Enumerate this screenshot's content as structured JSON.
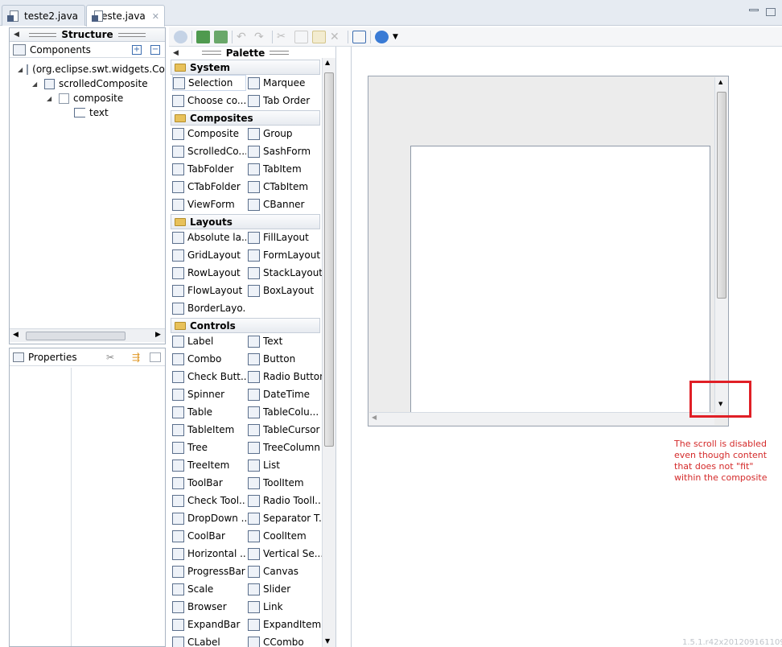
{
  "tabs": [
    {
      "label": "teste2.java",
      "active": false
    },
    {
      "label": "teste.java",
      "active": true
    }
  ],
  "structure": {
    "title": "Structure",
    "components_label": "Components",
    "tree": [
      {
        "label": "(org.eclipse.swt.widgets.Composite)",
        "level": 0
      },
      {
        "label": "scrolledComposite",
        "level": 1
      },
      {
        "label": "composite",
        "level": 2
      },
      {
        "label": "text",
        "level": 3
      }
    ]
  },
  "properties": {
    "title": "Properties"
  },
  "palette": {
    "title": "Palette",
    "categories": [
      {
        "name": "System",
        "items": [
          "Selection",
          "Marquee",
          "Choose co...",
          "Tab Order"
        ]
      },
      {
        "name": "Composites",
        "items": [
          "Composite",
          "Group",
          "ScrolledCo...",
          "SashForm",
          "TabFolder",
          "TabItem",
          "CTabFolder",
          "CTabItem",
          "ViewForm",
          "CBanner"
        ]
      },
      {
        "name": "Layouts",
        "items": [
          "Absolute la...",
          "FillLayout",
          "GridLayout",
          "FormLayout",
          "RowLayout",
          "StackLayout",
          "FlowLayout",
          "BoxLayout",
          "BorderLayo..."
        ]
      },
      {
        "name": "Controls",
        "items": [
          "Label",
          "Text",
          "Combo",
          "Button",
          "Check Butt...",
          "Radio Button",
          "Spinner",
          "DateTime",
          "Table",
          "TableColu...",
          "TableItem",
          "TableCursor",
          "Tree",
          "TreeColumn",
          "TreeItem",
          "List",
          "ToolBar",
          "ToolItem",
          "Check Tool...",
          "Radio Tooll...",
          "DropDown ...",
          "Separator T...",
          "CoolBar",
          "CoolItem",
          "Horizontal ...",
          "Vertical Se...",
          "ProgressBar",
          "Canvas",
          "Scale",
          "Slider",
          "Browser",
          "Link",
          "ExpandBar",
          "ExpandItem",
          "CLabel",
          "CCombo"
        ]
      }
    ]
  },
  "annotation": "The scroll is disabled even though content that does not \"fit\" within the composite",
  "version": "1.5.1.r42x201209161109"
}
